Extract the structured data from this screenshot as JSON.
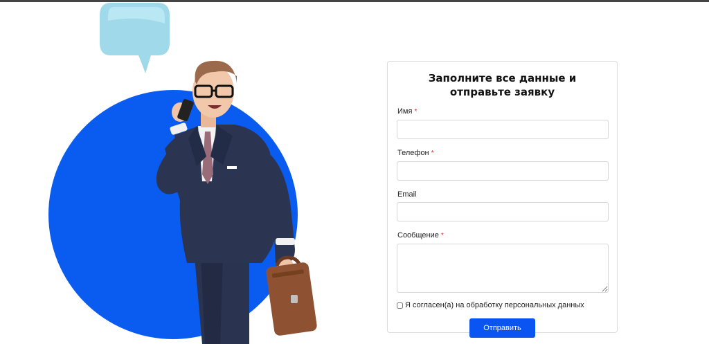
{
  "form": {
    "title": "Заполните все данные и отправьте заявку",
    "required_mark": "*",
    "fields": [
      {
        "label": "Имя",
        "required": true
      },
      {
        "label": "Телефон",
        "required": true
      },
      {
        "label": "Email",
        "required": false
      },
      {
        "label": "Сообщение",
        "required": true
      }
    ],
    "consent_label": "Я согласен(а) на обработку персональных данных",
    "submit_label": "Отправить"
  },
  "colors": {
    "accent": "#0a55f2",
    "required": "#e0262e",
    "circle": "#0a5cf0",
    "bubble": "#9fd9ea"
  },
  "illustration": {
    "icons": [
      "speech-bubble-icon",
      "blue-circle",
      "businessman-with-phone",
      "briefcase-icon"
    ]
  }
}
